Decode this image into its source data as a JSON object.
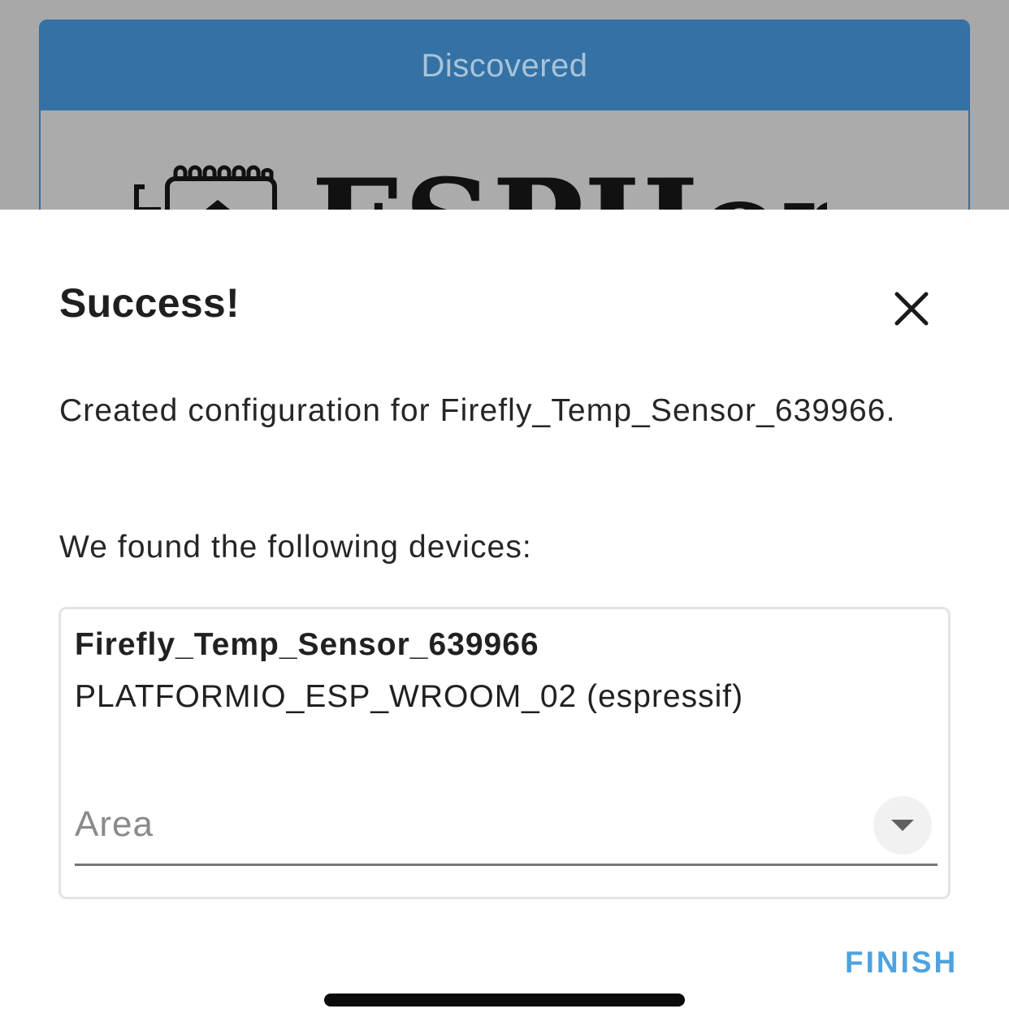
{
  "background": {
    "card_title": "Discovered",
    "logo_text": "ESPHome"
  },
  "dialog": {
    "title": "Success!",
    "created_text": "Created configuration for Firefly_Temp_Sensor_639966.",
    "found_text": "We found the following devices:",
    "device": {
      "name": "Firefly_Temp_Sensor_639966",
      "model": "PLATFORMIO_ESP_WROOM_02 (espressif)"
    },
    "area_field": {
      "label": "Area"
    },
    "finish_label": "FINISH"
  },
  "icons": {
    "close": "close-icon",
    "dropdown": "chevron-down-icon",
    "logo": "esphome-logo-icon"
  },
  "colors": {
    "header_blue": "#3472a5",
    "accent": "#4da3df",
    "backdrop": "#a8a8a8"
  }
}
